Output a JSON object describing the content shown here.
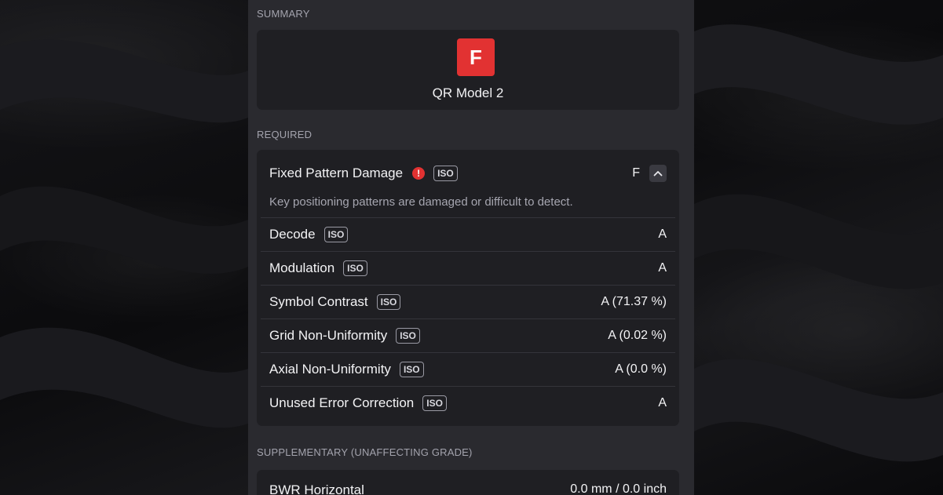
{
  "sections": {
    "summary_label": "SUMMARY",
    "required_label": "REQUIRED",
    "supplementary_label": "SUPPLEMENTARY (UNAFFECTING GRADE)"
  },
  "summary": {
    "grade": "F",
    "grade_color": "#e23232",
    "symbology": "QR Model 2"
  },
  "required": {
    "expanded": {
      "name": "Fixed Pattern Damage",
      "iso": "ISO",
      "value": "F",
      "description": "Key positioning patterns are damaged or difficult to detect."
    },
    "rows": [
      {
        "name": "Decode",
        "iso": "ISO",
        "value": "A"
      },
      {
        "name": "Modulation",
        "iso": "ISO",
        "value": "A"
      },
      {
        "name": "Symbol Contrast",
        "iso": "ISO",
        "value": "A (71.37 %)"
      },
      {
        "name": "Grid Non-Uniformity",
        "iso": "ISO",
        "value": "A (0.02 %)"
      },
      {
        "name": "Axial Non-Uniformity",
        "iso": "ISO",
        "value": "A (0.0 %)"
      },
      {
        "name": "Unused Error Correction",
        "iso": "ISO",
        "value": "A"
      }
    ]
  },
  "supplementary": {
    "rows": [
      {
        "name": "BWR Horizontal",
        "value": "0.0 mm / 0.0 inch"
      }
    ]
  }
}
